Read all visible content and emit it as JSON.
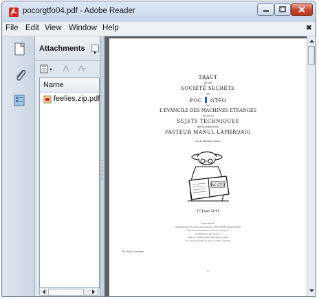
{
  "window": {
    "title": "pocorgtfo04.pdf - Adobe Reader"
  },
  "menu": {
    "items": [
      "File",
      "Edit",
      "View",
      "Window",
      "Help"
    ]
  },
  "attachments_panel": {
    "title": "Attachments",
    "column_header": "Name",
    "files": [
      {
        "name": "feelies.zip.pdf"
      }
    ]
  },
  "document": {
    "lines": {
      "l1": "TRACT",
      "l2": "by the",
      "l3": "SOCIÉTÉ SECRÈTE",
      "l4": "de",
      "l5": "POC",
      "l5b": "GTFO",
      "l6": "PoC",
      "l7": "L'ÉVANGILE DES MACHINES ÉTRANGES",
      "l8": "et tout le",
      "l9": "SUJETS TECHNIQUES",
      "l10": "par la publication",
      "l11": "PASTEUR MANUL LAPHROAIG",
      "l12": "aux la Bavaria Sauce",
      "date": "17 June 2014",
      "place": "MONTRÉAL",
      "p1": "Published by the Tract Association of POC||GTFO and Friends",
      "p2": "and to be distributed at WCT in Oregon",
      "p3": "beginning at the close of",
      "p4": "Hax for Children and the Cancer Gang",
      "p5": "Or can be found one at pocorgtfo-web.pdf",
      "side": "No Doth Construe",
      "page_num": "1"
    },
    "book_label": "PoC GTFO"
  },
  "colors": {
    "accent_close": "#c6422a",
    "doc_background": "#5d6065"
  }
}
